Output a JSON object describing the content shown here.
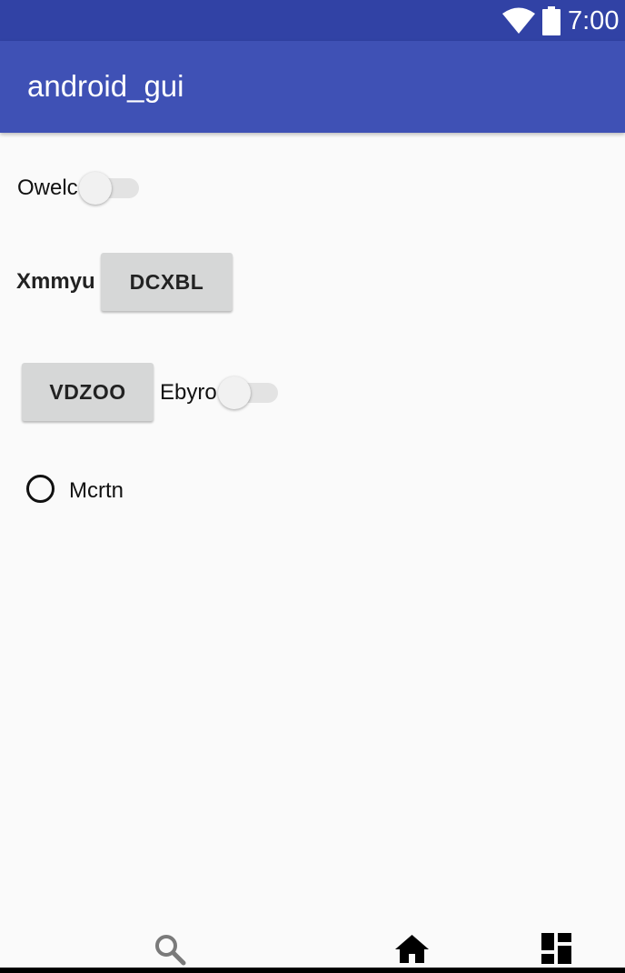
{
  "status_bar": {
    "time": "7:00",
    "wifi_icon": "wifi-icon",
    "battery_icon": "battery-icon",
    "background": "#3142a5"
  },
  "app_bar": {
    "title": "android_gui",
    "background": "#3f51b5"
  },
  "content": {
    "switch_owelc": {
      "label": "Owelc",
      "checked": false
    },
    "button_row": {
      "label": "Xmmyu",
      "button_label": "DCXBL"
    },
    "button_vdzoo": {
      "button_label": "VDZOO"
    },
    "switch_ebyro": {
      "label": "Ebyro",
      "checked": false
    },
    "radio_mcrtn": {
      "label": "Mcrtn",
      "checked": false
    }
  },
  "bottom_nav": {
    "icons": [
      "search-icon",
      "home-icon",
      "dashboard-icon"
    ]
  }
}
